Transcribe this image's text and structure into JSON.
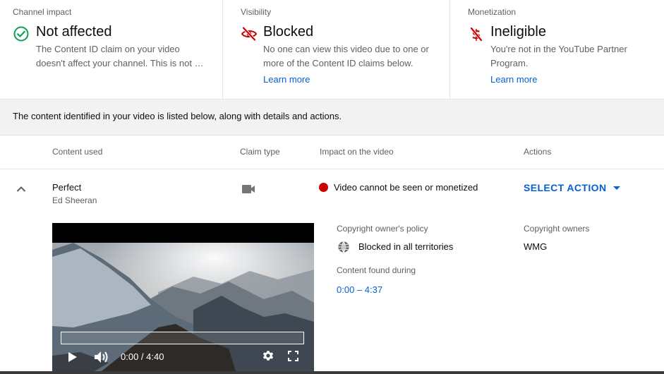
{
  "cards": [
    {
      "label": "Channel impact",
      "icon": "check-circle-icon",
      "status": "Not affected",
      "description": "The Content ID claim on your video doesn't affect your channel. This is not …",
      "link": ""
    },
    {
      "label": "Visibility",
      "icon": "eye-off-icon",
      "status": "Blocked",
      "description": "No one can view this video due to one or more of the Content ID claims below.",
      "link": "Learn more"
    },
    {
      "label": "Monetization",
      "icon": "dollar-off-icon",
      "status": "Ineligible",
      "description": "You're not in the YouTube Partner Program.",
      "link": "Learn more"
    }
  ],
  "info_bar": "The content identified in your video is listed below, along with details and actions.",
  "table": {
    "headers": [
      "Content used",
      "Claim type",
      "Impact on the video",
      "Actions"
    ],
    "row": {
      "title": "Perfect",
      "artist": "Ed Sheeran",
      "claim_icon": "video-camera-icon",
      "impact": "Video cannot be seen or monetized",
      "impact_color": "#cc0000",
      "action": "SELECT ACTION"
    }
  },
  "player": {
    "time": "0:00 / 4:40"
  },
  "details": {
    "policy_label": "Copyright owner's policy",
    "policy_value": "Blocked in all territories",
    "found_label": "Content found during",
    "found_value": "0:00 – 4:37",
    "owners_label": "Copyright owners",
    "owners_value": "WMG"
  },
  "colors": {
    "success": "#0f9d58",
    "blocked": "#cc0000",
    "link": "#065fd4"
  }
}
